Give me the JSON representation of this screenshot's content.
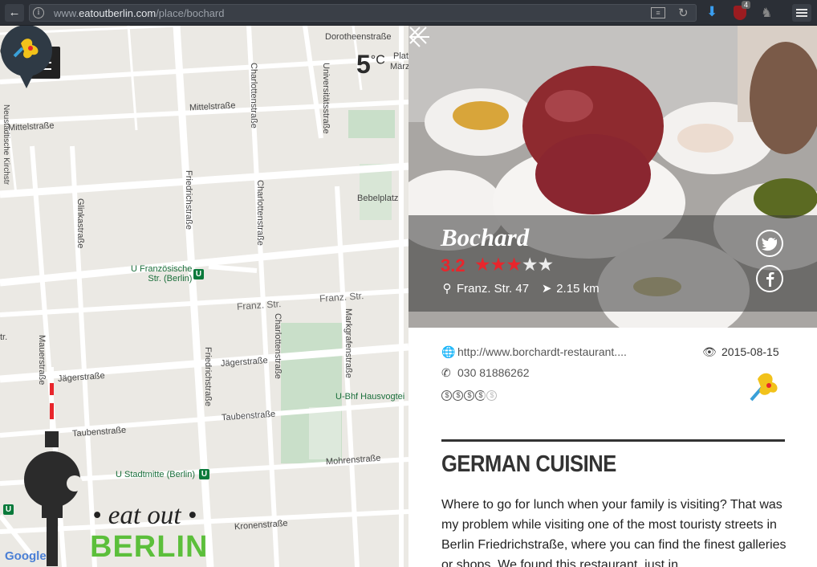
{
  "browser": {
    "url_prefix": "www.",
    "url_domain": "eatoutberlin.com",
    "url_path": "/place/bochard",
    "ublock_count": "4"
  },
  "map": {
    "streets": {
      "dorotheen": "Dorotheenstraße",
      "mittel_right": "Mittelstraße",
      "mittel_left": "Mittelstraße",
      "ndowstr": "Neustädtische Kirchstr",
      "charlotten_top": "Charlottenstraße",
      "universitaets": "Universitätsstraße",
      "friedrich_top": "Friedrichstraße",
      "charlotten_mid": "Charlottenstraße",
      "glinka": "Glinkastraße",
      "bebel": "Bebelplatz",
      "franz_left": "Franz. Str.",
      "franz_right": "Franz. Str.",
      "ubahn_franz": "U Französische\nStr. (Berlin)",
      "charlotten_low": "Charlottenstraße",
      "markgrafen": "Markgrafenstraße",
      "friedrich_low": "Friedrichstraße",
      "jaeger_mid": "Jägerstraße",
      "jaeger_left": "Jägerstraße",
      "mauer": "Mauerstraße",
      "hausvogtei": "U-Bhf Hausvogtei",
      "tauben_right": "Taubenstraße",
      "tauben_left": "Taubenstraße",
      "mohren": "Mohrenstraße",
      "stadtmitte": "U Stadtmitte (Berlin)",
      "kronen": "Kronenstraße",
      "str_left": "tr.",
      "platz_label": "Plat",
      "maerz_label": "März"
    },
    "weather": {
      "temperature": "5",
      "unit": "°C",
      "icon": "cloud-icon"
    },
    "google_label": "Google",
    "logo_line1": "• eat out •",
    "logo_line2": "BERLIN",
    "ubahn_symbol": "U"
  },
  "restaurant": {
    "name": "Bochard",
    "rating": "3.2",
    "stars_full": "★★★",
    "stars_empty": "★★",
    "address": "Franz. Str. 47",
    "distance": "2.15 km",
    "website": "http://www.borchardt-restaurant....",
    "phone": "030 81886262",
    "date": "2015-08-15",
    "price_full": [
      "$",
      "$",
      "$"
    ],
    "price_half": "$",
    "price_off": "$",
    "cuisine_heading": "GERMAN CUISINE",
    "description": "Where to go for lunch when your family is visiting? That was my problem while visiting one of the most touristy streets in Berlin Friedrichstraße, where you can find the finest galleries or shops. We found this restaurant, just in"
  },
  "colors": {
    "accent_red": "#e8262c",
    "logo_green": "#5cbf3b",
    "ubahn_green": "#0a7a3b"
  }
}
